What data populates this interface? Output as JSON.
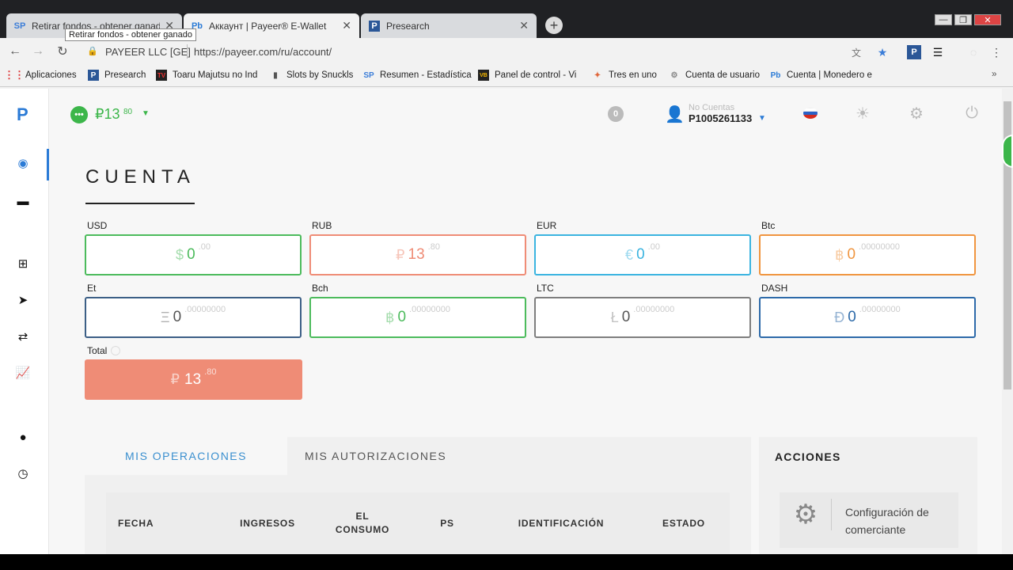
{
  "browser": {
    "tabs": [
      {
        "icon": "SP",
        "title": "Retirar fondos - obtener ganado",
        "active": false
      },
      {
        "icon": "Pb",
        "title": "Аккаунт | Payeer® E-Wallet",
        "active": true
      },
      {
        "icon": "P",
        "title": "Presearch",
        "active": false
      }
    ],
    "tooltip": "Retirar fondos - obtener ganado",
    "site_owner": "PAYEER LLC [GE]",
    "url": "https://payeer.com/ru/account/",
    "bookmarks": [
      {
        "icon": "apps-icon",
        "label": "Aplicaciones"
      },
      {
        "icon": "P",
        "label": "Presearch"
      },
      {
        "icon": "TV",
        "label": "Toaru Majutsu no Ind"
      },
      {
        "icon": "▮",
        "label": "Slots by Snuckls"
      },
      {
        "icon": "SP",
        "label": "Resumen - Estadística"
      },
      {
        "icon": "VB",
        "label": "Panel de control - Vi"
      },
      {
        "icon": "✦",
        "label": "Tres en uno"
      },
      {
        "icon": "⚙",
        "label": "Cuenta de usuario"
      },
      {
        "icon": "Pb",
        "label": "Cuenta | Monedero e"
      }
    ]
  },
  "app": {
    "logo": "P",
    "balance": {
      "main": "₽13",
      "cents": "80"
    },
    "notifications": "0",
    "account_label": "No Cuentas",
    "account_number": "P1005261133",
    "title": "CUENTA",
    "wallets": [
      {
        "label": "USD",
        "symbol": "$",
        "amount": "0",
        "decimals": ".00",
        "color": "#4cbb5c"
      },
      {
        "label": "RUB",
        "symbol": "₽",
        "amount": "13",
        "decimals": ".80",
        "color": "#ef8c76"
      },
      {
        "label": "EUR",
        "symbol": "€",
        "amount": "0",
        "decimals": ".00",
        "color": "#3bb4e0"
      },
      {
        "label": "Btc",
        "symbol": "฿",
        "amount": "0",
        "decimals": ".00000000",
        "color": "#f0953f"
      },
      {
        "label": "Et",
        "symbol": "Ξ",
        "amount": "0",
        "decimals": ".00000000",
        "color": "#3c5f86"
      },
      {
        "label": "Bch",
        "symbol": "฿",
        "amount": "0",
        "decimals": ".00000000",
        "color": "#4cbb5c"
      },
      {
        "label": "LTC",
        "symbol": "Ł",
        "amount": "0",
        "decimals": ".00000000",
        "color": "#7e7e7e"
      },
      {
        "label": "DASH",
        "symbol": "Đ",
        "amount": "0",
        "decimals": ".00000000",
        "color": "#2d6aa9"
      }
    ],
    "total": {
      "label": "Total",
      "symbol": "₽",
      "amount": "13",
      "decimals": ".80"
    },
    "operations": {
      "tabs": [
        "MIS OPERACIONES",
        "MIS AUTORIZACIONES"
      ],
      "columns": [
        "FECHA",
        "INGRESOS",
        "EL CONSUMO",
        "PS",
        "IDENTIFICACIÓN",
        "ESTADO"
      ]
    },
    "actions": {
      "title": "ACCIONES",
      "items": [
        "Configuración de comerciante"
      ]
    }
  }
}
